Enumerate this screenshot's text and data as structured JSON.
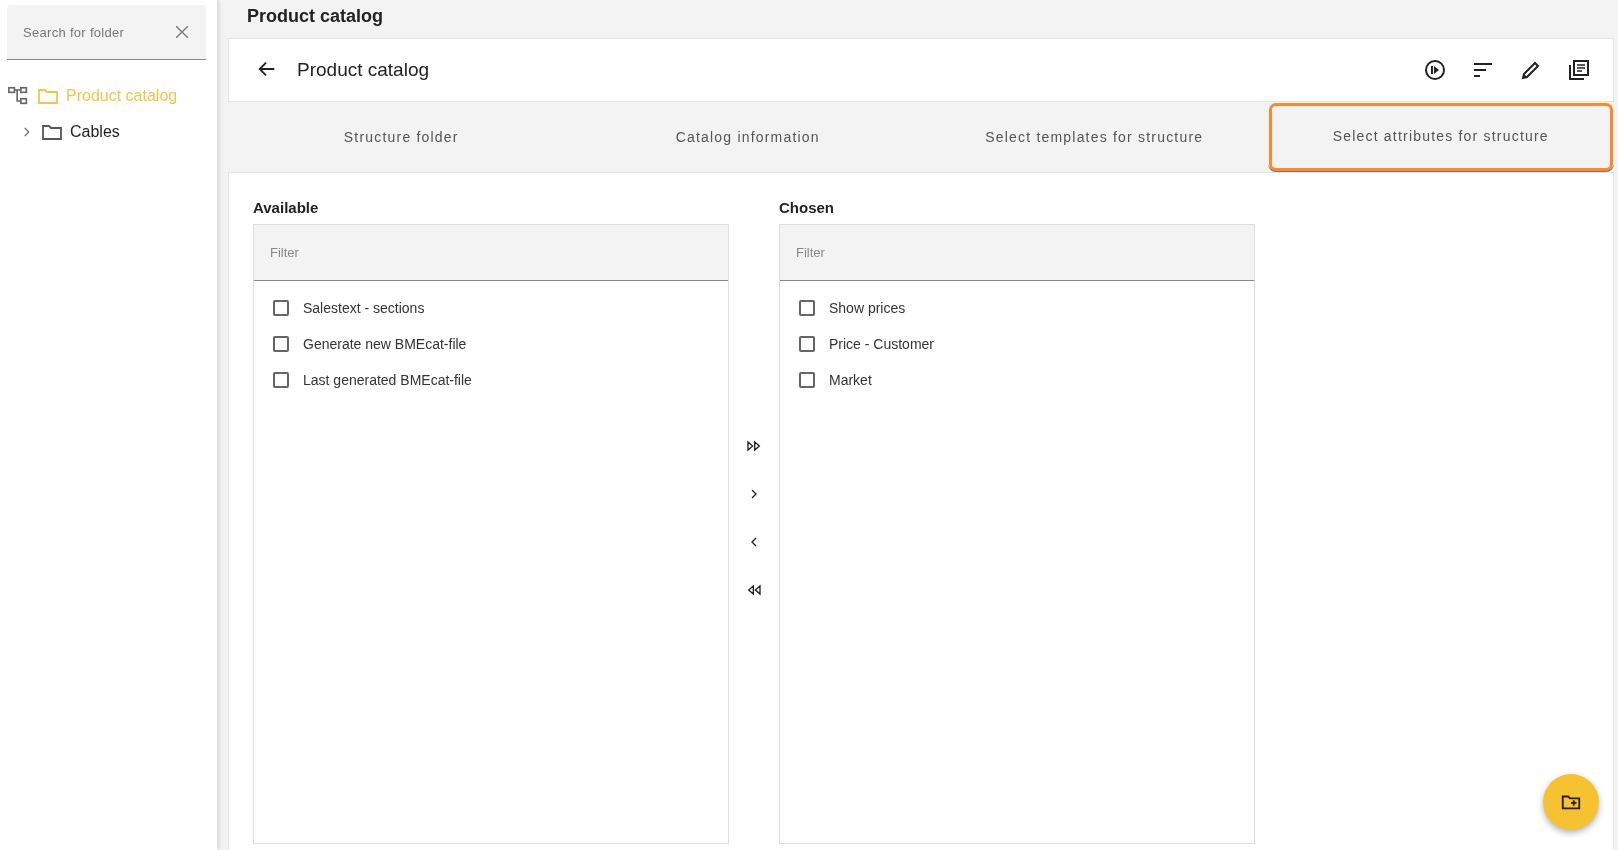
{
  "sidebar": {
    "search": {
      "placeholder": "Search for folder"
    },
    "tree": [
      {
        "label": "Product catalog",
        "selected": true,
        "children": [
          {
            "label": "Cables",
            "selected": false,
            "expanded": false
          }
        ]
      }
    ]
  },
  "page_title": "Product catalog",
  "header": {
    "title": "Product catalog"
  },
  "tabs": [
    {
      "label": "Structure folder",
      "selected": false
    },
    {
      "label": "Catalog information",
      "selected": false
    },
    {
      "label": "Select templates for structure",
      "selected": false
    },
    {
      "label": "Select attributes for structure",
      "selected": true
    }
  ],
  "available": {
    "label": "Available",
    "filter": {
      "placeholder": "Filter"
    },
    "items": [
      {
        "label": "Salestext - sections",
        "checked": false
      },
      {
        "label": "Generate new BMEcat-file",
        "checked": false
      },
      {
        "label": "Last generated BMEcat-file",
        "checked": false
      }
    ]
  },
  "chosen": {
    "label": "Chosen",
    "filter": {
      "placeholder": "Filter"
    },
    "items": [
      {
        "label": "Show prices",
        "checked": false
      },
      {
        "label": "Price - Customer",
        "checked": false
      },
      {
        "label": "Market",
        "checked": false
      }
    ]
  }
}
